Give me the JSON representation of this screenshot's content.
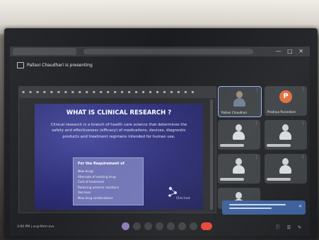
{
  "meet": {
    "presenting_label": "Pallavi Chaudhari is presenting"
  },
  "slide": {
    "title": "WHAT IS CLINICAL RESEARCH ?",
    "body": "Clinical research is a branch of health care science that determines the safety and effectiveness (efficacy) of medications, devices, diagnostic products and treatment regimens intended for human use.",
    "requirements_heading": "For the Requirement of",
    "requirements": [
      "New drugs",
      "Alternate of existing drug",
      "Cost of treatment",
      "Reducing adverse reactions",
      "Vaccines",
      "New drug combinations"
    ],
    "logo_text": "Clini Inst"
  },
  "participants": {
    "tiles": [
      {
        "name": "Pallavi Chaudhari"
      },
      {
        "name": "Pradnya Purandare",
        "initial": "P"
      }
    ]
  },
  "bottom_bar": {
    "meeting_time": "3:00 PM | ucg-fdrm-xvv"
  },
  "colors": {
    "slide_bg": "#2e2f78",
    "requirement_box": "#7276b6",
    "avatar_orange": "#e06d3b",
    "hangup_red": "#ea4335",
    "active_tile_border": "#8ab4f8"
  },
  "icons": [
    "presentation-icon",
    "mic-icon",
    "close-icon",
    "hangup-icon"
  ]
}
